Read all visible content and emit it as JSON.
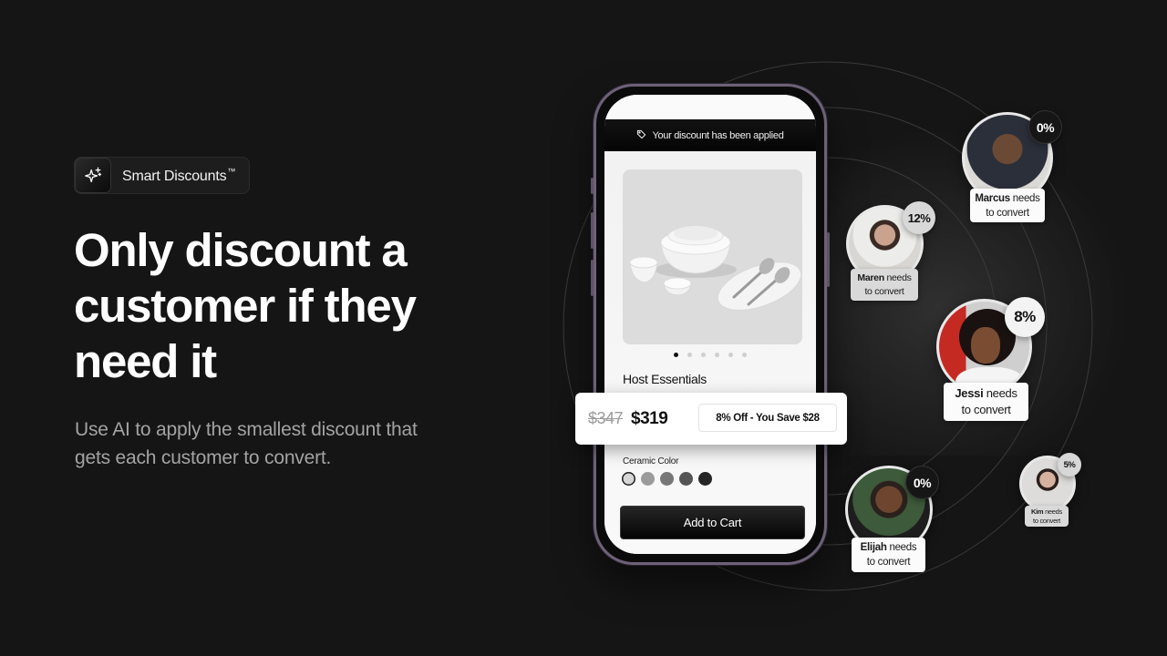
{
  "badge": {
    "label": "Smart Discounts",
    "trademark": "™",
    "icon": "sparkle-icon"
  },
  "headline": "Only discount a customer if they need it",
  "subtext": "Use AI to apply the smallest discount that gets each customer to convert.",
  "phone": {
    "discount_banner": {
      "icon": "tag-icon",
      "text": "Your discount has been applied"
    },
    "product": {
      "image": "dinnerware-set",
      "title": "Host Essentials",
      "carousel": {
        "count": 6,
        "active_index": 0
      },
      "color_label": "Ceramic Color",
      "colors": [
        "#d6d6d6",
        "#9b9b9b",
        "#777777",
        "#555555",
        "#262626"
      ],
      "selected_color_index": 0,
      "add_to_cart_label": "Add to Cart"
    }
  },
  "price_card": {
    "original_price": "$347",
    "discounted_price": "$319",
    "savings_label": "8% Off - You Save $28"
  },
  "customers": [
    {
      "name": "Marcus",
      "suffix": "needs",
      "line2": "to convert",
      "discount": "0%"
    },
    {
      "name": "Maren",
      "suffix": "needs",
      "line2": "to convert",
      "discount": "12%"
    },
    {
      "name": "Jessi",
      "suffix": "needs",
      "line2": "to convert",
      "discount": "8%"
    },
    {
      "name": "Elijah",
      "suffix": "needs",
      "line2": "to convert",
      "discount": "0%"
    },
    {
      "name": "Kim",
      "suffix": "needs",
      "line2": "to convert",
      "discount": "5%"
    }
  ]
}
